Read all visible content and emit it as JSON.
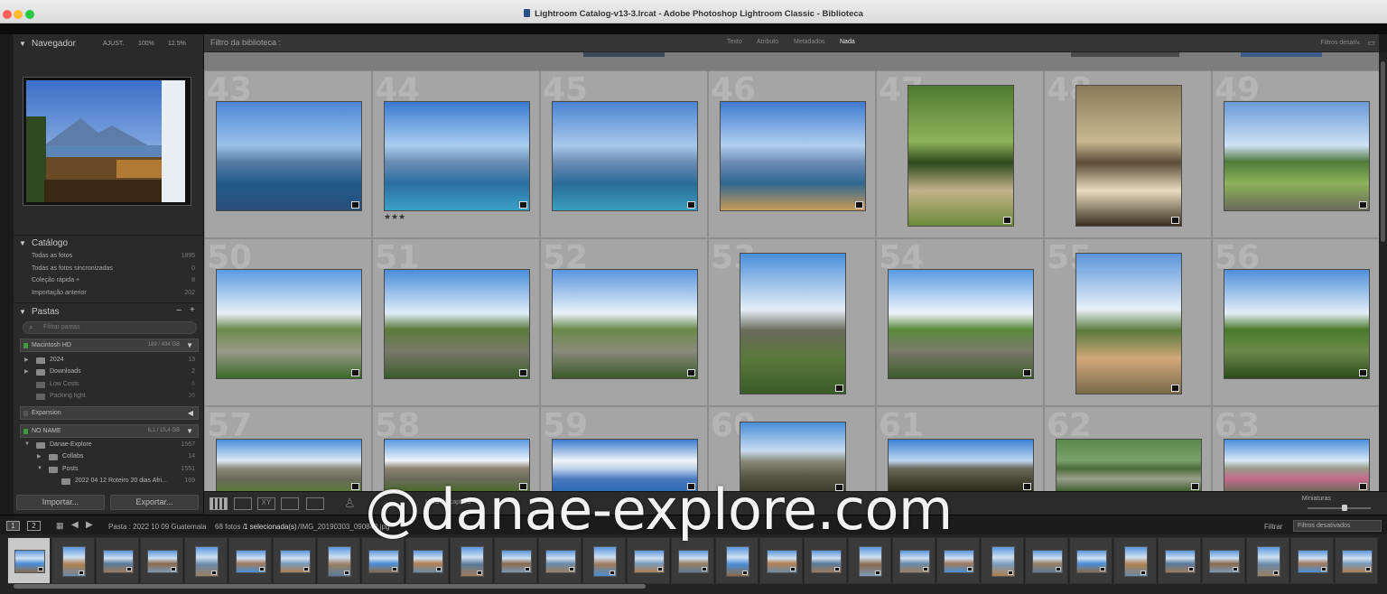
{
  "window": {
    "title": "Lightroom Catalog-v13-3.lrcat - Adobe Photoshop Lightroom Classic - Biblioteca"
  },
  "navigator": {
    "title": "Navegador",
    "zoom_options": [
      "AJUST.",
      "100%",
      "12.5%"
    ]
  },
  "catalog": {
    "title": "Catálogo",
    "items": [
      {
        "label": "Todas as fotos",
        "count": "1895"
      },
      {
        "label": "Todas as fotos sincronizadas",
        "count": "0"
      },
      {
        "label": "Coleção rápida +",
        "count": "8"
      },
      {
        "label": "Importação anterior",
        "count": "202"
      }
    ]
  },
  "folders": {
    "title": "Pastas",
    "search_placeholder": "Filtrar pastas",
    "volumes": [
      {
        "name": "Macintosh HD",
        "capacity": "189 / 494 GB"
      },
      {
        "name": "Expansion",
        "capacity": ""
      },
      {
        "name": "NO NAME",
        "capacity": "6,1 / 15,4 GB"
      }
    ],
    "mac_items": [
      {
        "label": "2024",
        "count": "13"
      },
      {
        "label": "Downloads",
        "count": "2"
      },
      {
        "label": "Low Costs",
        "count": "6"
      },
      {
        "label": "Packing light",
        "count": "36"
      }
    ],
    "noname_items": [
      {
        "label": "Danae-Explore",
        "count": "1567"
      },
      {
        "label": "Collabs",
        "count": "14"
      },
      {
        "label": "Posts",
        "count": "1551"
      },
      {
        "label": "2022 04 12 Roteiro 20 dias Afri...",
        "count": "169"
      }
    ]
  },
  "left_buttons": {
    "import": "Importar...",
    "export": "Exportar..."
  },
  "filter_bar": {
    "title": "Filtro da biblioteca :",
    "options": [
      "Texto",
      "Atributo",
      "Metadados",
      "Nada"
    ],
    "active": "Nada",
    "right": "Filtros desativ."
  },
  "grid": {
    "cells": [
      {
        "num": "43",
        "stars": ""
      },
      {
        "num": "44",
        "stars": "★★★"
      },
      {
        "num": "45",
        "stars": ""
      },
      {
        "num": "46",
        "stars": ""
      },
      {
        "num": "47",
        "stars": ""
      },
      {
        "num": "48",
        "stars": ""
      },
      {
        "num": "49",
        "stars": ""
      },
      {
        "num": "50",
        "stars": ""
      },
      {
        "num": "51",
        "stars": ""
      },
      {
        "num": "52",
        "stars": ""
      },
      {
        "num": "53",
        "stars": ""
      },
      {
        "num": "54",
        "stars": ""
      },
      {
        "num": "55",
        "stars": ""
      },
      {
        "num": "56",
        "stars": ""
      },
      {
        "num": "57",
        "stars": ""
      },
      {
        "num": "58",
        "stars": ""
      },
      {
        "num": "59",
        "stars": ""
      },
      {
        "num": "60",
        "stars": ""
      },
      {
        "num": "61",
        "stars": ""
      },
      {
        "num": "62",
        "stars": ""
      },
      {
        "num": "63",
        "stars": ""
      }
    ]
  },
  "toolbar": {
    "sort_label": "Hora de captura",
    "thumb_label": "Miniaturas",
    "thumb_size": 0.6
  },
  "filmstrip_header": {
    "screen1": "1",
    "screen2": "2",
    "path": "Pasta : 2022 10 09 Guatemala",
    "count": "68 fotos /",
    "selected": "1 selecionada(s)",
    "filename": "/IMG_20190303_090843.jpg",
    "filter_label": "Filtrar",
    "filter_value": "Filtros desativados"
  },
  "filmstrip": {
    "selected_index": 0,
    "count": 31
  },
  "watermark": "@danae-explore.com"
}
